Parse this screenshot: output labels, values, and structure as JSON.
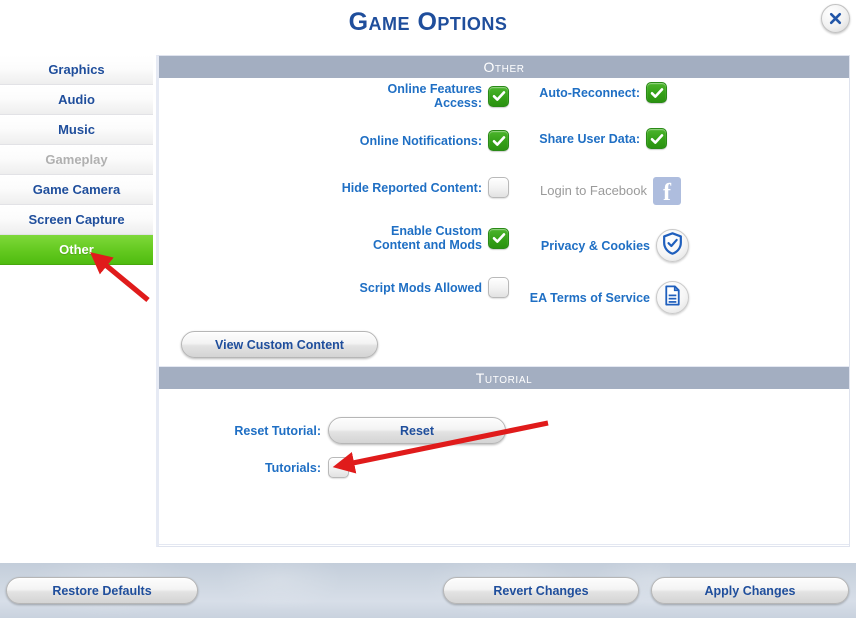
{
  "window": {
    "title": "Game Options",
    "close_label": "×",
    "close_icon": "close-icon"
  },
  "sidebar": {
    "tabs": [
      {
        "label": "Graphics",
        "state": "normal"
      },
      {
        "label": "Audio",
        "state": "normal"
      },
      {
        "label": "Music",
        "state": "normal"
      },
      {
        "label": "Gameplay",
        "state": "disabled"
      },
      {
        "label": "Game Camera",
        "state": "normal"
      },
      {
        "label": "Screen Capture",
        "state": "normal"
      },
      {
        "label": "Other",
        "state": "selected"
      }
    ]
  },
  "sections": [
    {
      "header": "Other",
      "left_options": [
        {
          "label": "Online Features\nAccess:",
          "checked": true,
          "icon": "checkbox-checked-icon"
        },
        {
          "label": "Online Notifications:",
          "checked": true,
          "icon": "checkbox-checked-icon"
        },
        {
          "label": "Hide Reported Content:",
          "checked": false,
          "icon": "checkbox-unchecked-icon"
        },
        {
          "label": "Enable Custom\nContent and Mods",
          "checked": true,
          "icon": "checkbox-checked-icon"
        },
        {
          "label": "Script Mods Allowed",
          "checked": false,
          "icon": "checkbox-unchecked-icon"
        }
      ],
      "right_options": [
        {
          "label": "Auto-Reconnect:",
          "checked": true,
          "icon": "checkbox-checked-icon",
          "type": "checkbox"
        },
        {
          "label": "Share User Data:",
          "checked": true,
          "icon": "checkbox-checked-icon",
          "type": "checkbox"
        },
        {
          "label": "Login to Facebook",
          "icon": "facebook-icon",
          "type": "icon",
          "muted": true,
          "glyph": "f"
        },
        {
          "label": "Privacy & Cookies",
          "icon": "shield-check-icon",
          "type": "icon"
        },
        {
          "label": "EA Terms of Service",
          "icon": "document-icon",
          "type": "icon"
        }
      ],
      "button": {
        "label": "View Custom Content"
      }
    },
    {
      "header": "Tutorial",
      "rows": [
        {
          "label": "Reset Tutorial:",
          "button_label": "Reset"
        },
        {
          "label": "Tutorials:",
          "checked": false,
          "icon": "checkbox-unchecked-icon"
        }
      ]
    }
  ],
  "footer": {
    "restore_label": "Restore Defaults",
    "revert_label": "Revert Changes",
    "apply_label": "Apply Changes"
  },
  "colors": {
    "title_blue": "#1f4e9c",
    "label_blue": "#1f6fc4",
    "selected_green": "#5fc71c",
    "section_header_gray": "#a3aec1",
    "checkbox_green": "#34a017",
    "annotation_red": "#e01b1b",
    "disabled_gray": "#b0b0b0",
    "footer_gray": "#ccd5e0"
  },
  "annotations": [
    {
      "name": "arrow-to-other-tab",
      "color": "#e01b1b"
    },
    {
      "name": "arrow-to-tutorials-checkbox",
      "color": "#e01b1b"
    }
  ]
}
